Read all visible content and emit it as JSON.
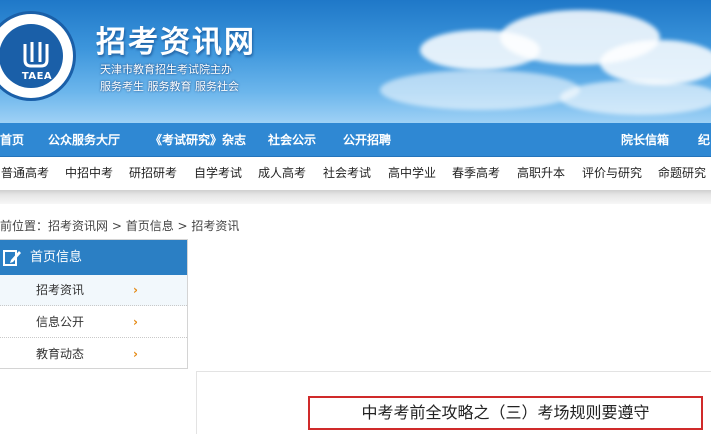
{
  "header": {
    "logo_text": "TAEA",
    "site_title": "招考资讯网",
    "slogan_line1": "天津市教育招生考试院主办",
    "slogan_line2": "服务考生 服务教育 服务社会"
  },
  "main_nav": {
    "items": [
      {
        "label": "首页"
      },
      {
        "label": "公众服务大厅"
      },
      {
        "label": "《考试研究》杂志"
      },
      {
        "label": "社会公示"
      },
      {
        "label": "公开招聘"
      },
      {
        "label": "院长信箱"
      },
      {
        "label": "纪"
      }
    ]
  },
  "sub_nav": {
    "items": [
      {
        "label": "普通高考"
      },
      {
        "label": "中招中考"
      },
      {
        "label": "研招研考"
      },
      {
        "label": "自学考试"
      },
      {
        "label": "成人高考"
      },
      {
        "label": "社会考试"
      },
      {
        "label": "高中学业"
      },
      {
        "label": "春季高考"
      },
      {
        "label": "高职升本"
      },
      {
        "label": "评价与研究"
      },
      {
        "label": "命题研究"
      }
    ]
  },
  "breadcrumb": {
    "prefix": "前位置：",
    "items": [
      "招考资讯网",
      "首页信息",
      "招考资讯"
    ],
    "separator": " > "
  },
  "sidebar": {
    "title": "首页信息",
    "items": [
      {
        "label": "招考资讯",
        "arrow": "›",
        "active": true
      },
      {
        "label": "信息公开",
        "arrow": "›",
        "active": false
      },
      {
        "label": "教育动态",
        "arrow": "›",
        "active": false
      }
    ]
  },
  "article": {
    "title": "中考考前全攻略之（三）考场规则要遵守"
  },
  "colors": {
    "banner": "#2f88d3",
    "nav": "#2f88d3",
    "sidebar_head": "#2b7fc4",
    "arrow": "#e48a15",
    "highlight_border": "#d02a2a"
  }
}
